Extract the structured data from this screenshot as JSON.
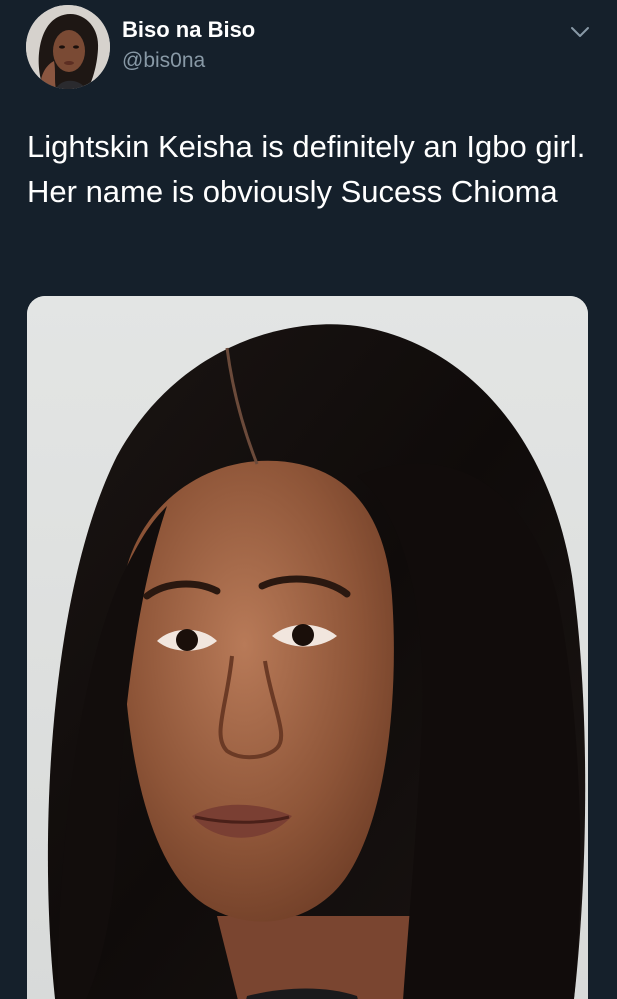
{
  "tweet": {
    "author": {
      "display_name": "Biso na Biso",
      "handle": "@bis0na",
      "avatar_icon": "profile-photo"
    },
    "more_icon": "chevron-down-icon",
    "text": "Lightskin Keisha is definitely an Igbo girl. Her name is obviously Sucess Chioma",
    "media": {
      "icon": "photo-portrait"
    }
  },
  "colors": {
    "background": "#15202b",
    "primary_text": "#ffffff",
    "secondary_text": "#8899a6"
  }
}
